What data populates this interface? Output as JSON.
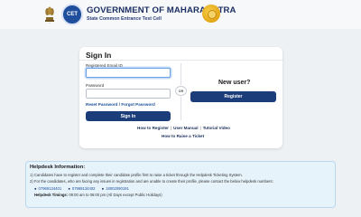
{
  "header": {
    "title": "GOVERNMENT OF MAHARASHTRA",
    "subtitle": "State Common Entrance Test Cell",
    "logo_text": "CET",
    "emblem_icon": "ashoka-emblem-icon",
    "seal_icon": "maharashtra-seal-icon"
  },
  "signin": {
    "title": "Sign In",
    "email_label": "Registered Email ID",
    "email_value": "",
    "password_label": "Password",
    "password_value": "",
    "forgot_link": "Reset Password / Forgot Password",
    "button": "Sign In"
  },
  "divider": {
    "or_label": "OR"
  },
  "register": {
    "heading": "New user?",
    "button": "Register"
  },
  "links": {
    "how_to_register": "How to Register",
    "user_manual": "User Manual",
    "tutorial_video": "Tutorial Video",
    "raise_ticket": "How to Raise a Ticket"
  },
  "helpdesk": {
    "title": "Helpdesk Information:",
    "line1": "1) Candidates have to register and complete their candidate profile first to raise a ticket through the Helpdesk Ticketing System.",
    "line2": "2) For the candidates, who are facing any issues in registration and are unable to create their profile, please contact the below helpdesk numbers:",
    "phones": [
      "07969134401",
      "07969134402",
      "18002090191"
    ],
    "timings_label": "Helpdesk Timings:",
    "timings_value": "09:00 am to 06:00 pm (All Days except Public Holidays)"
  },
  "colors": {
    "primary_button": "#1b3d7a",
    "link": "#1c4f9c",
    "helpdesk_bg": "#e7f3fb"
  }
}
